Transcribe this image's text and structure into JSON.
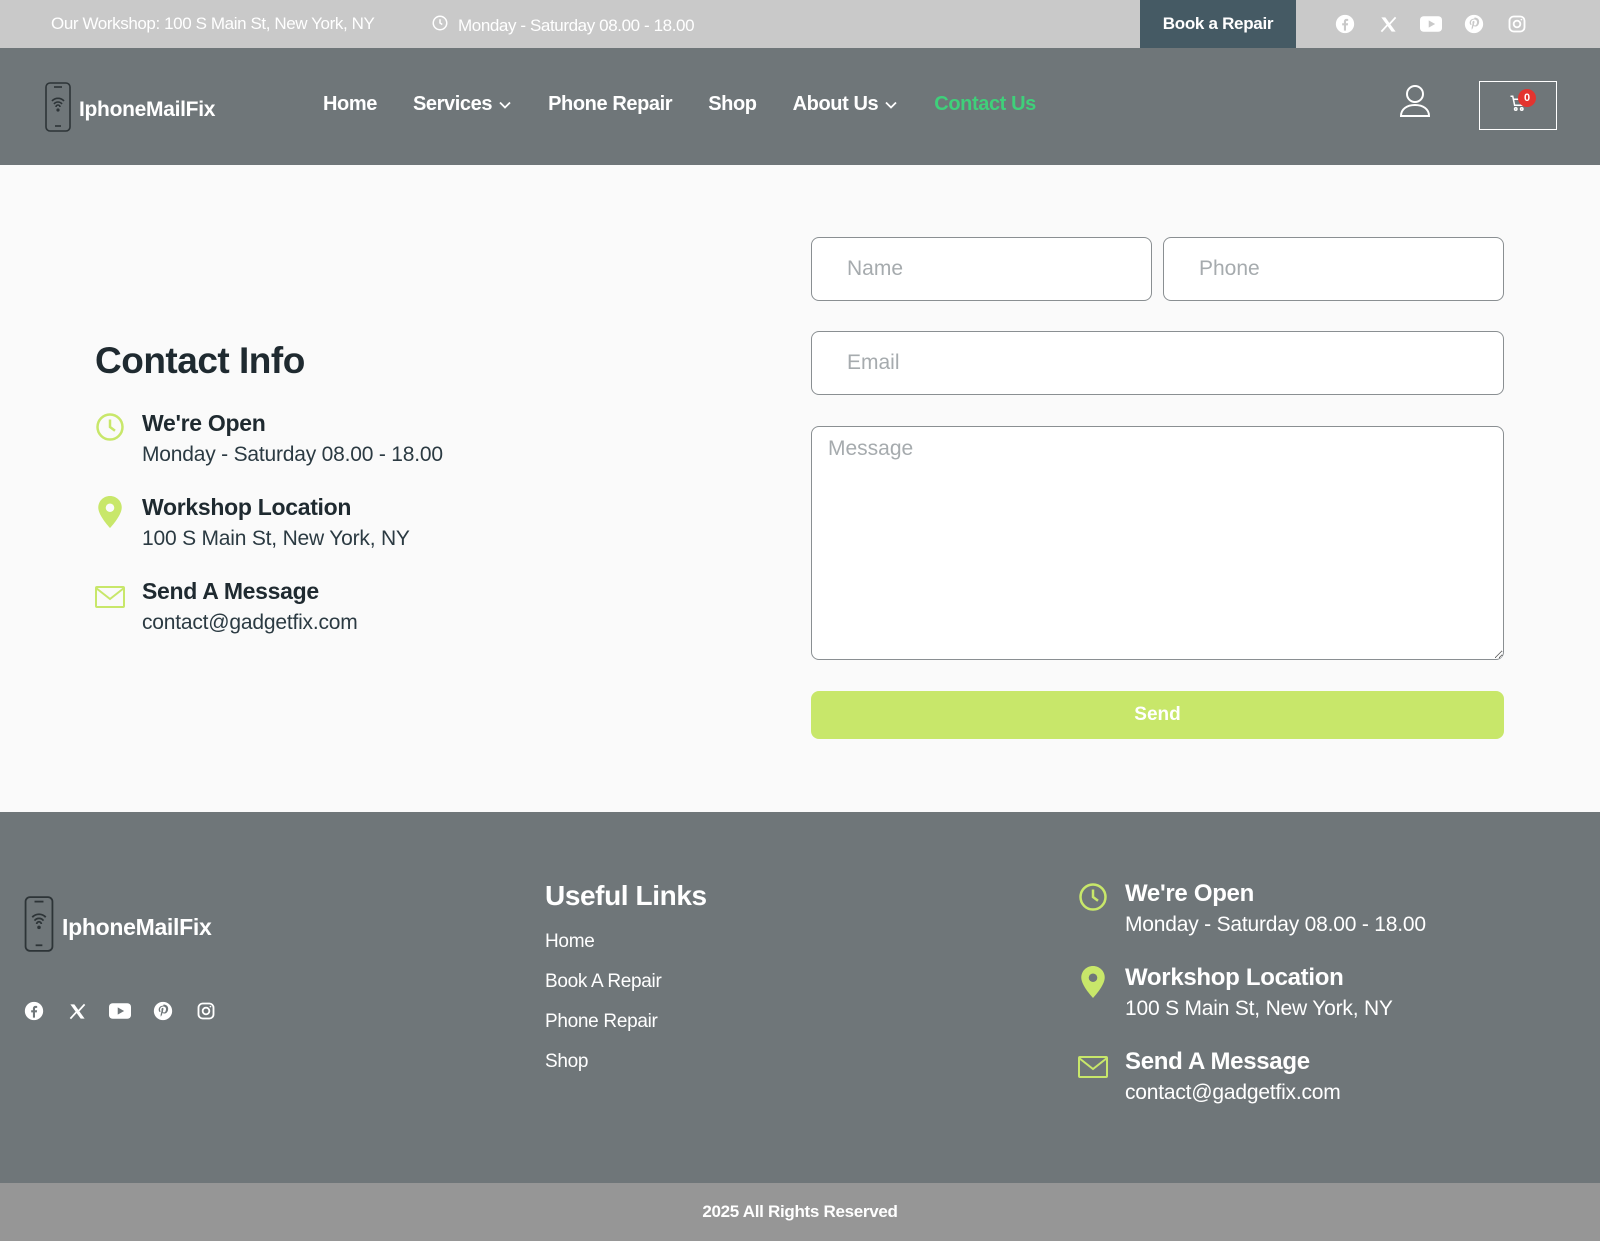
{
  "topbar": {
    "address": "Our Workshop: 100 S Main St, New York, NY",
    "hours": "Monday - Saturday 08.00 - 18.00",
    "book_label": "Book a Repair",
    "socials": [
      "facebook-icon",
      "x-icon",
      "youtube-icon",
      "pinterest-icon",
      "instagram-icon"
    ]
  },
  "brand": {
    "name": "IphoneMailFix"
  },
  "nav": {
    "items": [
      {
        "label": "Home"
      },
      {
        "label": "Services"
      },
      {
        "label": "Phone Repair"
      },
      {
        "label": "Shop"
      },
      {
        "label": "About Us"
      },
      {
        "label": "Contact Us"
      }
    ],
    "active": "Contact Us",
    "cart_count": "0"
  },
  "contact": {
    "title": "Contact Info",
    "items": [
      {
        "icon": "clock-icon",
        "title": "We're Open",
        "text": "Monday - Saturday 08.00 - 18.00"
      },
      {
        "icon": "map-pin-icon",
        "title": "Workshop Location",
        "text": "100 S Main St, New York, NY"
      },
      {
        "icon": "mail-icon",
        "title": "Send A Message",
        "text": "contact@gadgetfix.com"
      }
    ]
  },
  "form": {
    "name_placeholder": "Name",
    "phone_placeholder": "Phone",
    "email_placeholder": "Email",
    "message_placeholder": "Message",
    "send_label": "Send"
  },
  "footer": {
    "useful_title": "Useful Links",
    "links": [
      {
        "label": "Home"
      },
      {
        "label": "Book A Repair"
      },
      {
        "label": "Phone Repair"
      },
      {
        "label": "Shop"
      }
    ],
    "copyright": "2025 All Rights Reserved"
  },
  "colors": {
    "accent_green": "#c8e76a",
    "nav_active": "#3fd07a",
    "header_bg": "#6f7679",
    "topbar_bg": "#c9c9c9",
    "book_bg": "#455a64",
    "bottom_bg": "#969696",
    "badge": "#e3342f"
  }
}
